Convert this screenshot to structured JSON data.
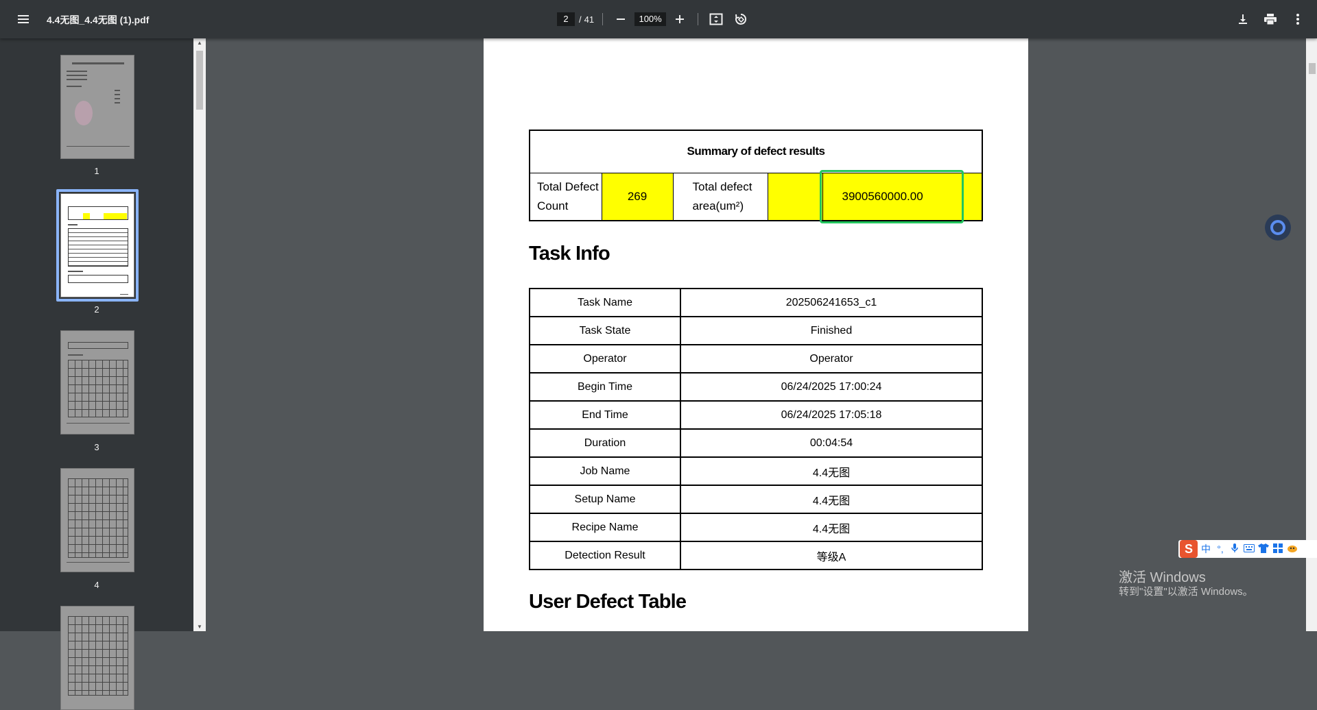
{
  "toolbar": {
    "file_name": "4.4无图_4.4无图 (1).pdf",
    "current_page": "2",
    "page_separator": "/",
    "total_pages": "41",
    "zoom": "100%"
  },
  "sidebar": {
    "thumbnails": [
      {
        "number": "1",
        "selected": false
      },
      {
        "number": "2",
        "selected": true
      },
      {
        "number": "3",
        "selected": false
      },
      {
        "number": "4",
        "selected": false
      }
    ]
  },
  "document": {
    "summary": {
      "title": "Summary of defect results",
      "total_defect_count_label": "Total Defect Count",
      "total_defect_count_value": "269",
      "total_defect_area_label": "Total defect area(um²)",
      "total_defect_area_value": "3900560000.00"
    },
    "task_info_heading": "Task Info",
    "task_info": [
      {
        "key": "Task Name",
        "value": "202506241653_c1"
      },
      {
        "key": "Task State",
        "value": "Finished"
      },
      {
        "key": "Operator",
        "value": "Operator"
      },
      {
        "key": "Begin Time",
        "value": "06/24/2025 17:00:24"
      },
      {
        "key": "End Time",
        "value": "06/24/2025 17:05:18"
      },
      {
        "key": "Duration",
        "value": "00:04:54"
      },
      {
        "key": "Job Name",
        "value": "4.4无图"
      },
      {
        "key": "Setup Name",
        "value": "4.4无图"
      },
      {
        "key": "Recipe Name",
        "value": "4.4无图"
      },
      {
        "key": "Detection Result",
        "value": "等级A"
      }
    ],
    "user_defect_heading": "User Defect Table"
  },
  "ime": {
    "logo": "S",
    "mode": "中",
    "punct": "°,"
  },
  "watermark": {
    "line1": "激活 Windows",
    "line2": "转到\"设置\"以激活 Windows。"
  },
  "colors": {
    "highlight_yellow": "#ffff00",
    "focus_green": "#22c55e",
    "selected_thumb_border": "#8ab4f8"
  }
}
